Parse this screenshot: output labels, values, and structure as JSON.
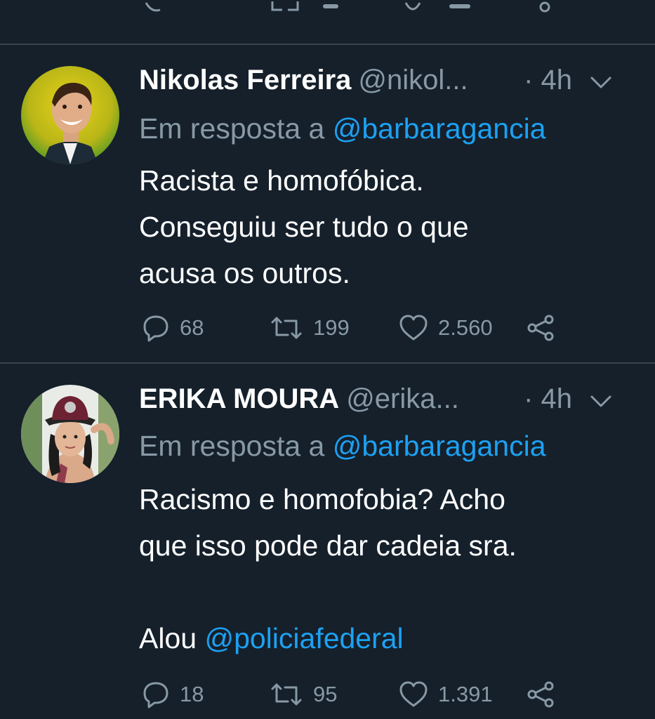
{
  "tweets": [
    {
      "name": "Nikolas Ferreira",
      "handle": "@nikol...",
      "time": "· 4h",
      "reply_prefix": "Em resposta a ",
      "reply_mention": "@barbaragancia",
      "lines": [
        "Racista e homofóbica.",
        "Conseguiu ser tudo o que",
        "acusa os outros."
      ],
      "replies": "68",
      "retweets": "199",
      "likes": "2.560"
    },
    {
      "name": "ERIKA MOURA",
      "handle": "@erika...",
      "time": "· 4h",
      "reply_prefix": "Em resposta a ",
      "reply_mention": "@barbaragancia",
      "lines": [
        "Racismo e homofobia? Acho",
        "que isso pode dar cadeia sra."
      ],
      "last_line_prefix": "Alou ",
      "last_line_mention": "@policiafederal",
      "replies": "18",
      "retweets": "95",
      "likes": "1.391"
    }
  ],
  "colors": {
    "background": "#15202b",
    "divider": "#38444d",
    "secondary_text": "#8899a6",
    "link": "#1da1f2",
    "primary_text": "#ffffff"
  },
  "icons": {
    "reply": "reply-icon",
    "retweet": "retweet-icon",
    "like": "heart-icon",
    "share": "share-icon",
    "menu": "chevron-down-icon"
  }
}
